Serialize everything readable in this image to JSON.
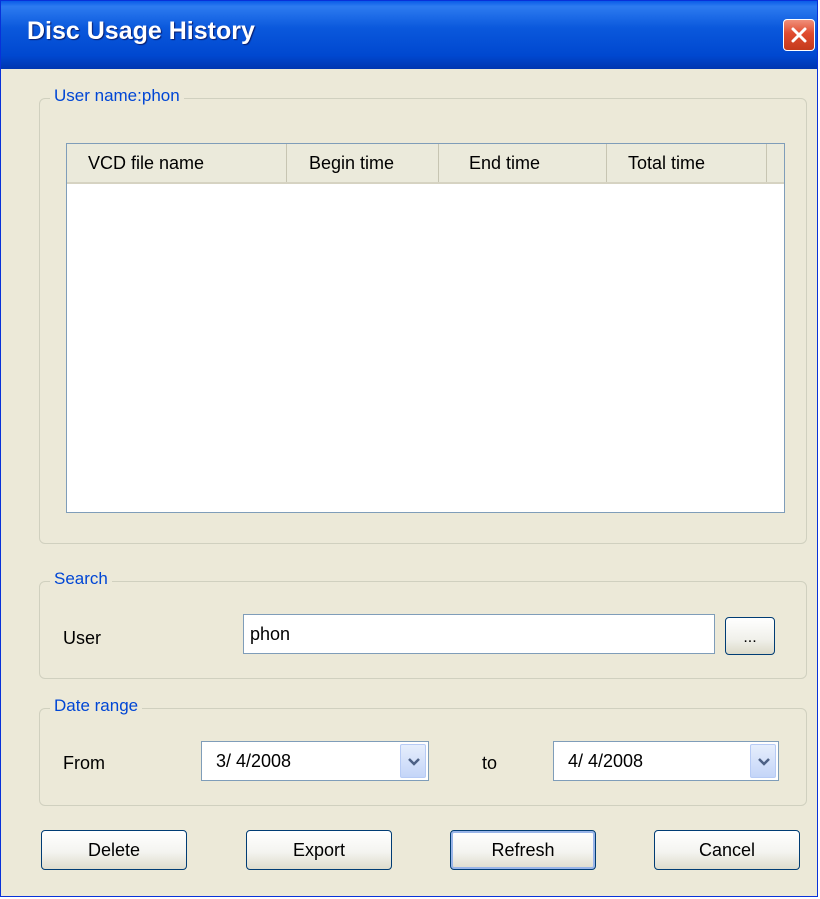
{
  "window": {
    "title": "Disc Usage History"
  },
  "history_group": {
    "legend": "User name:phon",
    "columns": [
      "VCD file name",
      "Begin time",
      "End time",
      "Total time"
    ],
    "rows": []
  },
  "search_group": {
    "legend": "Search",
    "user_label": "User",
    "user_value": "phon",
    "browse_label": "..."
  },
  "date_group": {
    "legend": "Date range",
    "from_label": "From",
    "from_value": "3/ 4/2008",
    "to_label": "to",
    "to_value": "4/ 4/2008"
  },
  "buttons": {
    "delete": "Delete",
    "export": "Export",
    "refresh": "Refresh",
    "cancel": "Cancel"
  },
  "colors": {
    "titlebar": "#0A58DC",
    "dialog_bg": "#ECE9D8",
    "legend_text": "#0046D5",
    "close_button": "#E04B2F"
  }
}
